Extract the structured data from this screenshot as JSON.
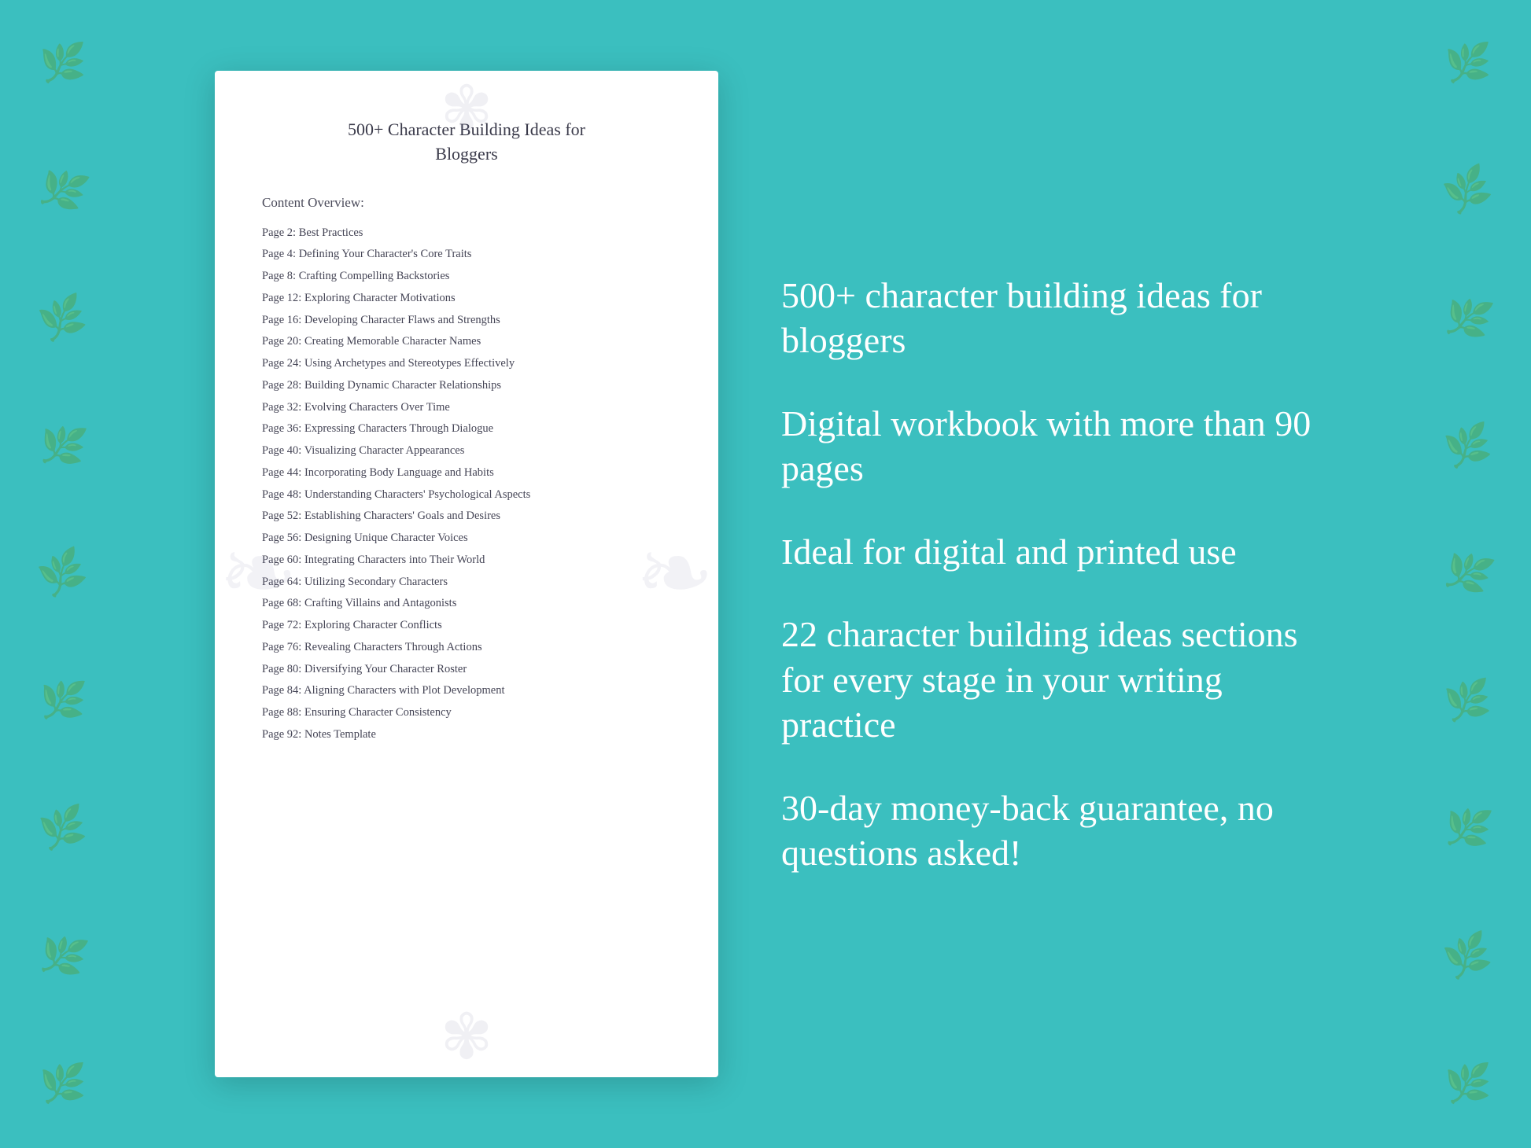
{
  "background": {
    "color": "#3bbfbf"
  },
  "document": {
    "title_line1": "500+ Character Building Ideas for",
    "title_line2": "Bloggers",
    "section_label": "Content Overview:",
    "toc": [
      {
        "page": "Page  2:",
        "title": "Best Practices"
      },
      {
        "page": "Page  4:",
        "title": "Defining Your Character's Core Traits"
      },
      {
        "page": "Page  8:",
        "title": "Crafting Compelling Backstories"
      },
      {
        "page": "Page 12:",
        "title": "Exploring Character Motivations"
      },
      {
        "page": "Page 16:",
        "title": "Developing Character Flaws and Strengths"
      },
      {
        "page": "Page 20:",
        "title": "Creating Memorable Character Names"
      },
      {
        "page": "Page 24:",
        "title": "Using Archetypes and Stereotypes Effectively"
      },
      {
        "page": "Page 28:",
        "title": "Building Dynamic Character Relationships"
      },
      {
        "page": "Page 32:",
        "title": "Evolving Characters Over Time"
      },
      {
        "page": "Page 36:",
        "title": "Expressing Characters Through Dialogue"
      },
      {
        "page": "Page 40:",
        "title": "Visualizing Character Appearances"
      },
      {
        "page": "Page 44:",
        "title": "Incorporating Body Language and Habits"
      },
      {
        "page": "Page 48:",
        "title": "Understanding Characters' Psychological Aspects"
      },
      {
        "page": "Page 52:",
        "title": "Establishing Characters' Goals and Desires"
      },
      {
        "page": "Page 56:",
        "title": "Designing Unique Character Voices"
      },
      {
        "page": "Page 60:",
        "title": "Integrating Characters into Their World"
      },
      {
        "page": "Page 64:",
        "title": "Utilizing Secondary Characters"
      },
      {
        "page": "Page 68:",
        "title": "Crafting Villains and Antagonists"
      },
      {
        "page": "Page 72:",
        "title": "Exploring Character Conflicts"
      },
      {
        "page": "Page 76:",
        "title": "Revealing Characters Through Actions"
      },
      {
        "page": "Page 80:",
        "title": "Diversifying Your Character Roster"
      },
      {
        "page": "Page 84:",
        "title": "Aligning Characters with Plot Development"
      },
      {
        "page": "Page 88:",
        "title": "Ensuring Character Consistency"
      },
      {
        "page": "Page 92:",
        "title": "Notes Template"
      }
    ]
  },
  "features": [
    {
      "text": "500+ character building ideas for bloggers"
    },
    {
      "text": "Digital workbook with more than 90 pages"
    },
    {
      "text": "Ideal for digital and printed use"
    },
    {
      "text": "22 character building ideas sections for every stage in your writing practice"
    },
    {
      "text": "30-day money-back guarantee, no questions asked!"
    }
  ],
  "floral_sprigs": [
    "❧",
    "✿",
    "❧",
    "✿",
    "❧",
    "✿",
    "❧",
    "✿",
    "❧"
  ],
  "deco_symbol": "✾"
}
